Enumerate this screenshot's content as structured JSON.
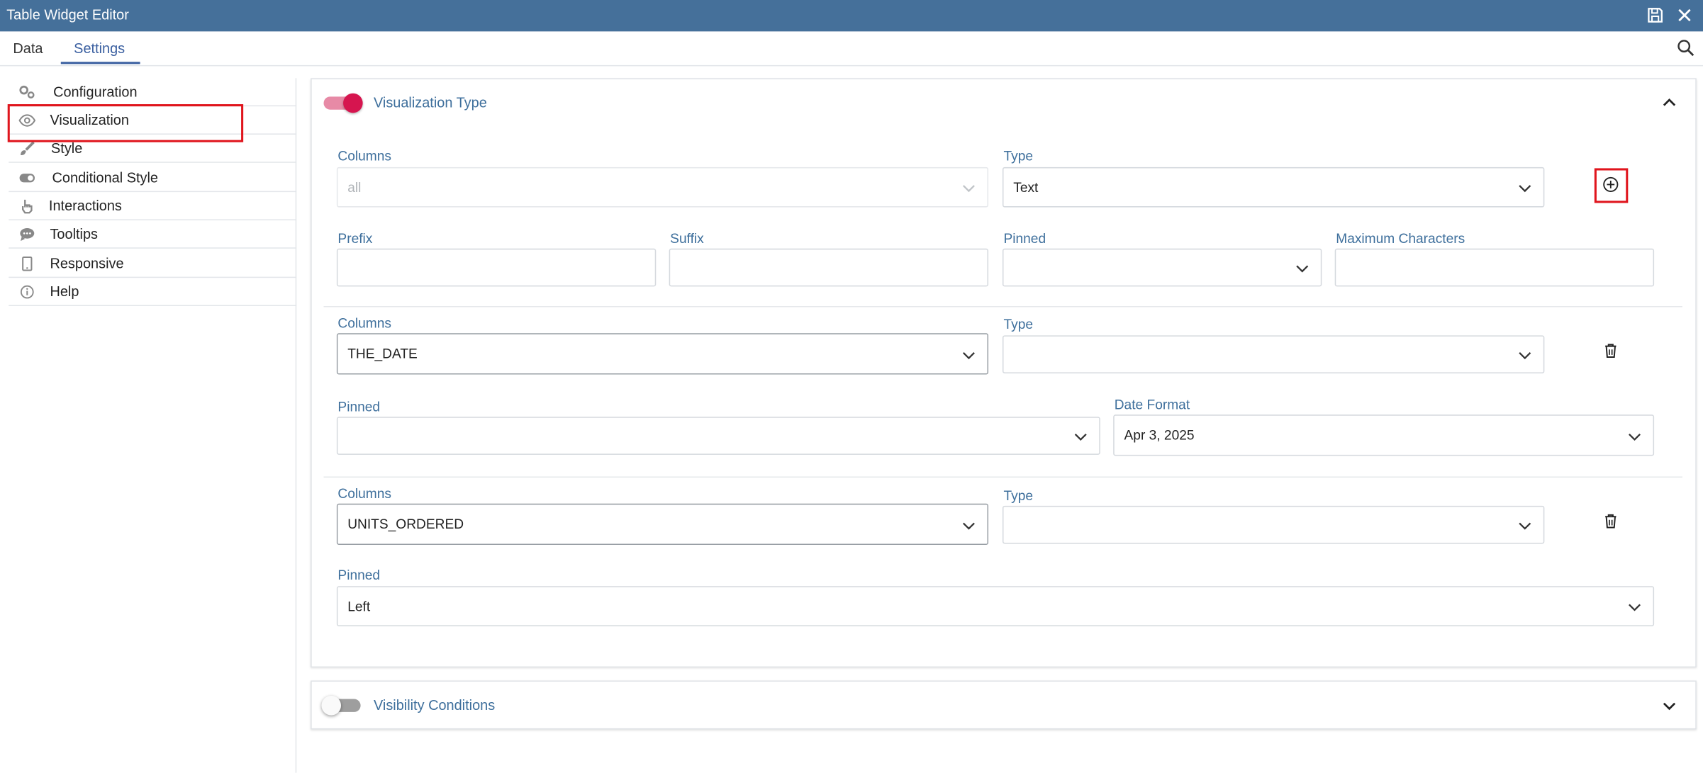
{
  "window": {
    "title": "Table Widget Editor",
    "save_icon": "save-icon",
    "close_icon": "close-icon"
  },
  "tabs": [
    {
      "label": "Data",
      "active": false
    },
    {
      "label": "Settings",
      "active": true
    }
  ],
  "search_icon": "search-icon",
  "sidebar": {
    "selected": "Visualization",
    "items": [
      {
        "label": "Configuration",
        "icon": "gears-icon"
      },
      {
        "label": "Visualization",
        "icon": "eye-icon"
      },
      {
        "label": "Style",
        "icon": "brush-icon"
      },
      {
        "label": "Conditional Style",
        "icon": "toggle-icon"
      },
      {
        "label": "Interactions",
        "icon": "hand-pointer-icon"
      },
      {
        "label": "Tooltips",
        "icon": "comment-icon"
      },
      {
        "label": "Responsive",
        "icon": "tablet-icon"
      },
      {
        "label": "Help",
        "icon": "info-icon"
      }
    ]
  },
  "visualization_panel": {
    "title": "Visualization Type",
    "enabled": true,
    "expanded": true,
    "rule1": {
      "columns_label": "Columns",
      "columns_value": "all",
      "type_label": "Type",
      "type_value": "Text",
      "prefix_label": "Prefix",
      "prefix_value": "",
      "suffix_label": "Suffix",
      "suffix_value": "",
      "pinned_label": "Pinned",
      "pinned_value": "",
      "max_chars_label": "Maximum Characters",
      "max_chars_value": ""
    },
    "rule2": {
      "columns_label": "Columns",
      "columns_value": "THE_DATE",
      "type_label": "Type",
      "type_value": "",
      "pinned_label": "Pinned",
      "pinned_value": "",
      "date_format_label": "Date Format",
      "date_format_value": "Apr 3, 2025"
    },
    "rule3": {
      "columns_label": "Columns",
      "columns_value": "UNITS_ORDERED",
      "type_label": "Type",
      "type_value": "",
      "pinned_label": "Pinned",
      "pinned_value": "Left"
    }
  },
  "visibility_panel": {
    "title": "Visibility Conditions",
    "enabled": false,
    "expanded": false
  },
  "colors": {
    "titlebar": "#45709a",
    "accent": "#3e6f9c",
    "toggle_on": "#d6154f",
    "highlight": "#e0151d"
  }
}
